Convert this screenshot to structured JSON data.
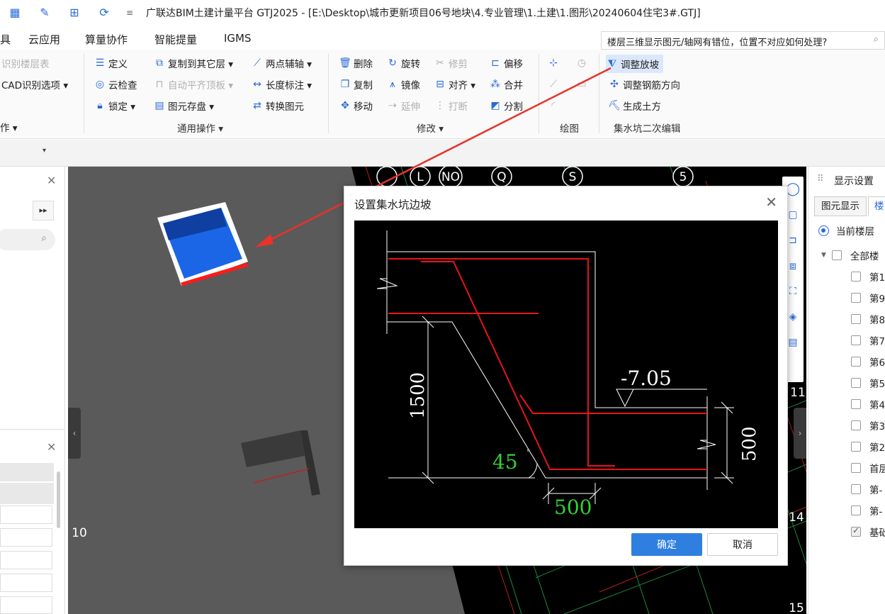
{
  "titlebar": {
    "title": "广联达BIM土建计量平台 GTJ2025 - [E:\\Desktop\\城市更新项目06号地块\\4.专业管理\\1.土建\\1.图形\\20240604住宅3#.GTJ]"
  },
  "menubar": {
    "items": [
      "具",
      "云应用",
      "算量协作",
      "智能提量",
      "IGMS"
    ],
    "help_text": "楼层三维显示图元/轴网有错位，位置不对应如何处理?"
  },
  "ribbon": {
    "left_items": [
      "识别楼层表",
      "CAD识别选项 ▾",
      "作 ▾"
    ],
    "general": {
      "define": "定义",
      "copy_layer": "复制到其它层 ▾",
      "two_point_axis": "两点辅轴 ▾",
      "cloud_check": "云检查",
      "auto_align_top": "自动平齐顶板 ▾",
      "length_dim": "长度标注 ▾",
      "lock": "锁定 ▾",
      "save_element": "图元存盘 ▾",
      "convert_element": "转换图元",
      "group_label": "通用操作 ▾"
    },
    "modify": {
      "delete": "删除",
      "rotate": "旋转",
      "trim": "修剪",
      "offset": "偏移",
      "copy": "复制",
      "mirror": "镜像",
      "align": "对齐 ▾",
      "merge": "合并",
      "move": "移动",
      "extend": "延伸",
      "break": "打断",
      "split": "分割",
      "group_label": "修改 ▾"
    },
    "draw": {
      "group_label": "绘图"
    },
    "sump": {
      "adjust_slope": "调整放坡",
      "adjust_rebar": "调整钢筋方向",
      "gen_earthwork": "生成土方",
      "group_label": "集水坑二次编辑"
    }
  },
  "right_panel": {
    "title": "显示设置",
    "tabs": [
      "图元显示",
      "楼"
    ],
    "radio_label": "当前楼层",
    "tree_root": "全部楼",
    "floors": [
      "第1",
      "第9",
      "第8",
      "第7",
      "第6",
      "第5",
      "第4",
      "第3",
      "第2",
      "首层",
      "第-",
      "第-",
      "基础"
    ]
  },
  "viewport": {
    "axis_labels_top": [
      "L",
      "NO",
      "Q",
      "S",
      "5"
    ],
    "axis_labels_right": [
      "11",
      "14",
      "15"
    ],
    "axis_label_left": "10"
  },
  "dialog": {
    "title": "设置集水坑边坡",
    "ok": "确定",
    "cancel": "取消",
    "drawing": {
      "elevation": "-7.05",
      "depth": "1500",
      "angle": "45",
      "bottom_width": "500",
      "right_dim": "500"
    }
  },
  "colors": {
    "accent": "#2f7fe0",
    "annotation_arrow": "#e8322a"
  }
}
